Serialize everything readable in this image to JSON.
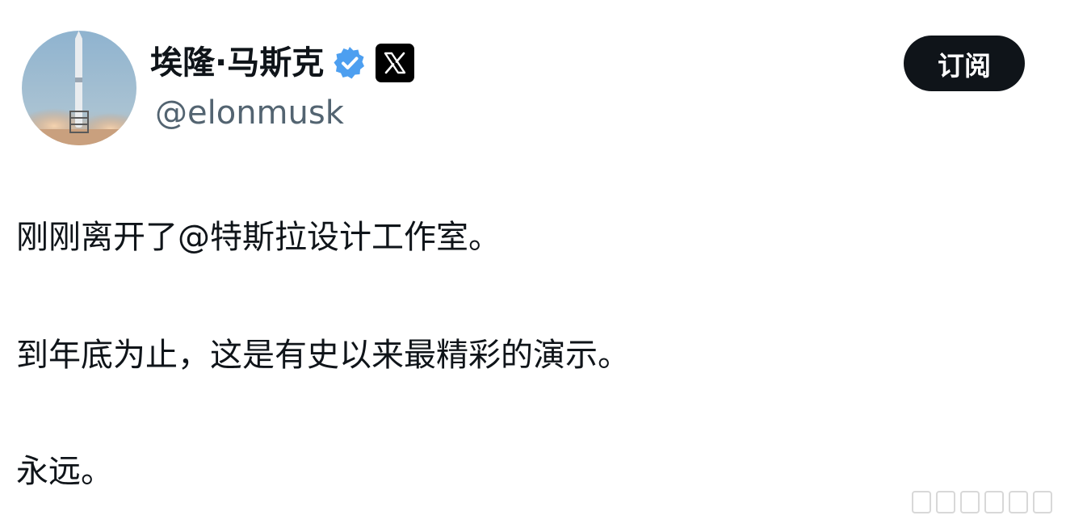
{
  "post": {
    "author": {
      "display_name": "埃隆·马斯克",
      "handle": "@elonmusk",
      "verified_icon": "verified-badge-icon",
      "platform_badge_icon": "x-logo-icon"
    },
    "subscribe_label": "订阅",
    "text_lines": [
      "刚刚离开了@特斯拉设计工作室。",
      "到年底为止，这是有史以来最精彩的演示。",
      "永远。"
    ]
  },
  "colors": {
    "verified_blue": "#4d9ff0",
    "button_bg": "#0f1419",
    "handle_gray": "#536471"
  }
}
